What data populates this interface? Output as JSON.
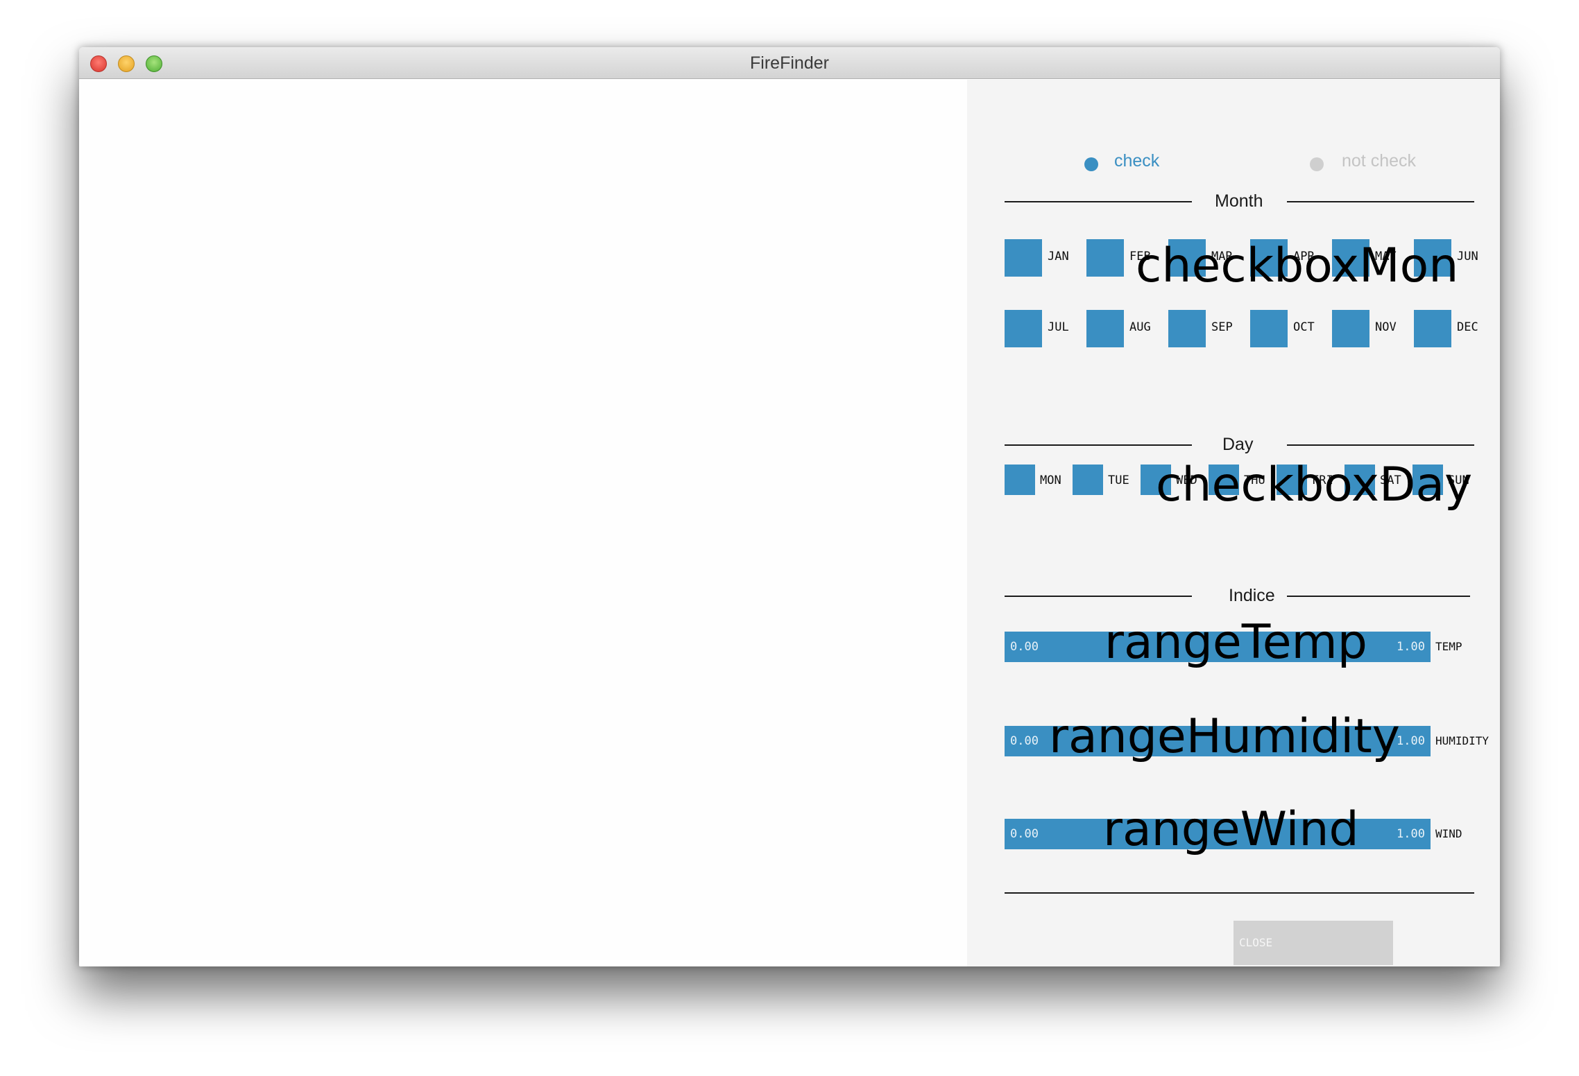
{
  "window": {
    "title": "FireFinder"
  },
  "legend": {
    "check": {
      "label": "check",
      "color": "#3a8fc2"
    },
    "not_check": {
      "label": "not check",
      "color": "#cfcfcf"
    }
  },
  "sections": {
    "month": "Month",
    "day": "Day",
    "indice": "Indice"
  },
  "months": [
    "JAN",
    "FEB",
    "MAR",
    "APR",
    "MAY",
    "JUN",
    "JUL",
    "AUG",
    "SEP",
    "OCT",
    "NOV",
    "DEC"
  ],
  "days": [
    "MON",
    "TUE",
    "WED",
    "THU",
    "FRI",
    "SAT",
    "SUN"
  ],
  "group_labels": {
    "month": "checkboxMon",
    "day": "checkboxDay"
  },
  "ranges": [
    {
      "name": "rangeTemp",
      "low": "0.00",
      "high": "1.00",
      "side": "TEMP"
    },
    {
      "name": "rangeHumidity",
      "low": "0.00",
      "high": "1.00",
      "side": "HUMIDITY"
    },
    {
      "name": "rangeWind",
      "low": "0.00",
      "high": "1.00",
      "side": "WIND"
    }
  ],
  "close_button": {
    "label": "CLOSE"
  },
  "colors": {
    "accent": "#3a8fc2",
    "panel_bg": "#f4f4f4",
    "button_bg": "#d2d2d2"
  }
}
